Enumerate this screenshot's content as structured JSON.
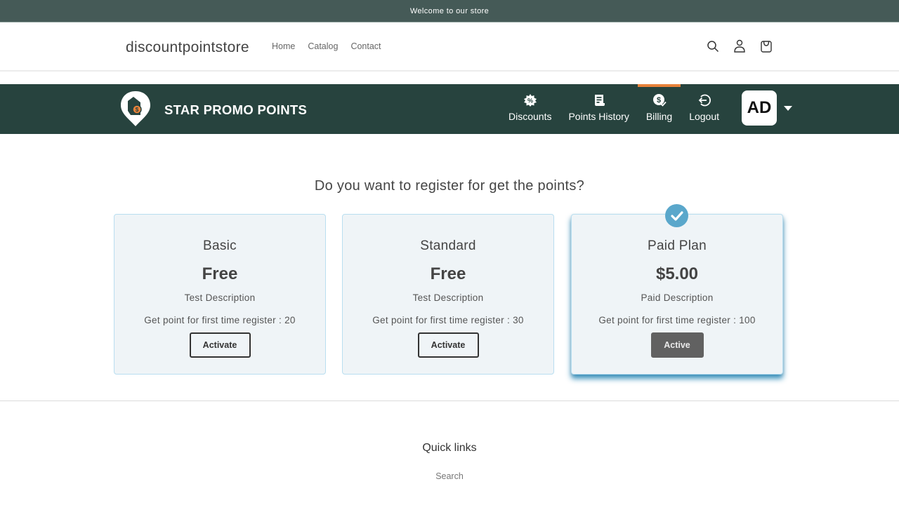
{
  "announcement": "Welcome to our store",
  "store": {
    "name": "discountpointstore",
    "nav": [
      "Home",
      "Catalog",
      "Contact"
    ],
    "icons": [
      "search-icon",
      "account-icon",
      "cart-icon"
    ]
  },
  "app": {
    "title": "STAR PROMO POINTS",
    "nav": [
      {
        "label": "Discounts",
        "icon": "discount-badge-icon",
        "active": false
      },
      {
        "label": "Points History",
        "icon": "receipt-icon",
        "active": false
      },
      {
        "label": "Billing",
        "icon": "billing-dollar-icon",
        "active": true
      },
      {
        "label": "Logout",
        "icon": "logout-icon",
        "active": false
      }
    ],
    "avatar_initials": "AD",
    "active_color": "#e8823a",
    "bar_color": "#27433e"
  },
  "question": "Do you want to register for get the points?",
  "plans": [
    {
      "name": "Basic",
      "price": "Free",
      "description": "Test Description",
      "register_points": "Get point for first time register : 20",
      "button": "Activate",
      "selected": false
    },
    {
      "name": "Standard",
      "price": "Free",
      "description": "Test Description",
      "register_points": "Get point for first time register : 30",
      "button": "Activate",
      "selected": false
    },
    {
      "name": "Paid Plan",
      "price": "$5.00",
      "description": "Paid Description",
      "register_points": "Get point for first time register : 100",
      "button": "Active",
      "selected": true
    }
  ],
  "footer": {
    "quick_links_title": "Quick links",
    "links": [
      "Search"
    ]
  }
}
